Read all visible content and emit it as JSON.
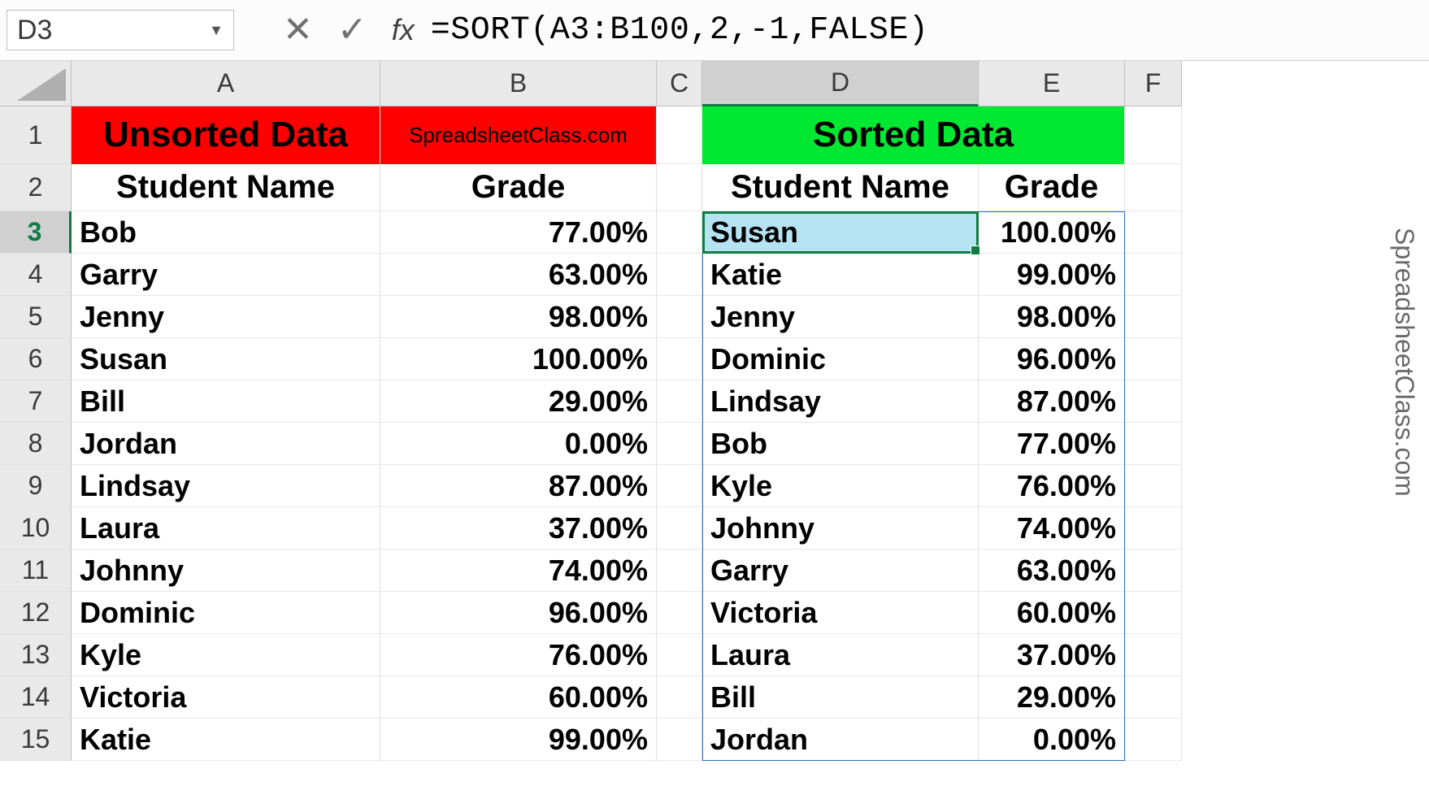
{
  "nameBox": "D3",
  "formula": "=SORT(A3:B100,2,-1,FALSE)",
  "fxLabel": "fx",
  "columns": [
    "A",
    "B",
    "C",
    "D",
    "E",
    "F"
  ],
  "rows": [
    "1",
    "2",
    "3",
    "4",
    "5",
    "6",
    "7",
    "8",
    "9",
    "10",
    "11",
    "12",
    "13",
    "14",
    "15"
  ],
  "headers": {
    "unsorted": "Unsorted Data",
    "attribution": "SpreadsheetClass.com",
    "sorted": "Sorted Data",
    "studentName": "Student Name",
    "grade": "Grade"
  },
  "unsorted": [
    {
      "name": "Bob",
      "grade": "77.00%"
    },
    {
      "name": "Garry",
      "grade": "63.00%"
    },
    {
      "name": "Jenny",
      "grade": "98.00%"
    },
    {
      "name": "Susan",
      "grade": "100.00%"
    },
    {
      "name": "Bill",
      "grade": "29.00%"
    },
    {
      "name": "Jordan",
      "grade": "0.00%"
    },
    {
      "name": "Lindsay",
      "grade": "87.00%"
    },
    {
      "name": "Laura",
      "grade": "37.00%"
    },
    {
      "name": "Johnny",
      "grade": "74.00%"
    },
    {
      "name": "Dominic",
      "grade": "96.00%"
    },
    {
      "name": "Kyle",
      "grade": "76.00%"
    },
    {
      "name": "Victoria",
      "grade": "60.00%"
    },
    {
      "name": "Katie",
      "grade": "99.00%"
    }
  ],
  "sorted": [
    {
      "name": "Susan",
      "grade": "100.00%"
    },
    {
      "name": "Katie",
      "grade": "99.00%"
    },
    {
      "name": "Jenny",
      "grade": "98.00%"
    },
    {
      "name": "Dominic",
      "grade": "96.00%"
    },
    {
      "name": "Lindsay",
      "grade": "87.00%"
    },
    {
      "name": "Bob",
      "grade": "77.00%"
    },
    {
      "name": "Kyle",
      "grade": "76.00%"
    },
    {
      "name": "Johnny",
      "grade": "74.00%"
    },
    {
      "name": "Garry",
      "grade": "63.00%"
    },
    {
      "name": "Victoria",
      "grade": "60.00%"
    },
    {
      "name": "Laura",
      "grade": "37.00%"
    },
    {
      "name": "Bill",
      "grade": "29.00%"
    },
    {
      "name": "Jordan",
      "grade": "0.00%"
    }
  ],
  "watermarkSide": "SpreadsheetClass.com",
  "activeCol": "D",
  "activeRow": "3"
}
